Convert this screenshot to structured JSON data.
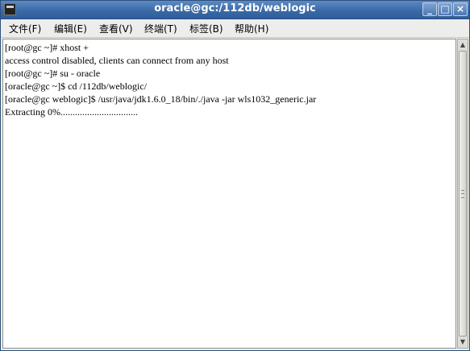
{
  "window": {
    "title": "oracle@gc:/112db/weblogic",
    "controls": {
      "minimize": "_",
      "maximize": "□",
      "close": "×"
    }
  },
  "menu": [
    {
      "label": "文件(F)"
    },
    {
      "label": "编辑(E)"
    },
    {
      "label": "查看(V)"
    },
    {
      "label": "终端(T)"
    },
    {
      "label": "标签(B)"
    },
    {
      "label": "帮助(H)"
    }
  ],
  "terminal": {
    "lines": [
      "[root@gc ~]# xhost +",
      "access control disabled, clients can connect from any host",
      "[root@gc ~]# su - oracle",
      "[oracle@gc ~]$ cd /112db/weblogic/",
      "[oracle@gc weblogic]$ /usr/java/jdk1.6.0_18/bin/./java -jar wls1032_generic.jar",
      "Extracting 0%................................"
    ]
  },
  "scrollbar": {
    "up_arrow": "▲",
    "down_arrow": "▼"
  }
}
